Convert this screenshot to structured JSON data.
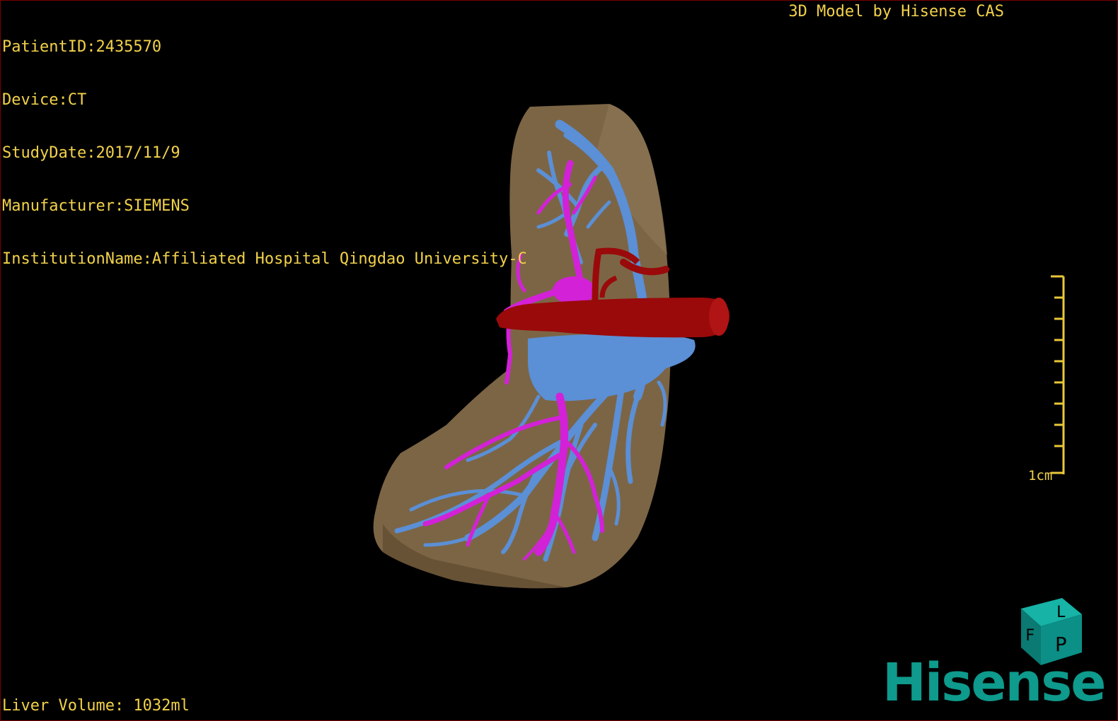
{
  "header": {
    "patient_id": "PatientID:2435570",
    "device": "Device:CT",
    "study_date": "StudyDate:2017/11/9",
    "manufacturer": "Manufacturer:SIEMENS",
    "institution": "InstitutionName:Affiliated Hospital Qingdao University-C",
    "model_credit": "3D Model by Hisense CAS"
  },
  "footer": {
    "liver_volume": "Liver Volume: 1032ml"
  },
  "scale_bar": {
    "label": "1cm",
    "color": "#e8c83a"
  },
  "orientation_cube": {
    "face_front": "P",
    "face_top": "L",
    "face_left": "F",
    "color": "#0b8f86"
  },
  "logo": {
    "text": "Hisense",
    "color": "#0e9a8c"
  },
  "colors": {
    "liver": "#7c6545",
    "portal_vein": "#5b8fd6",
    "hepatic_artery": "#d321d8",
    "vena_cava": "#9a0a0a",
    "overlay_text": "#f2d24a"
  }
}
